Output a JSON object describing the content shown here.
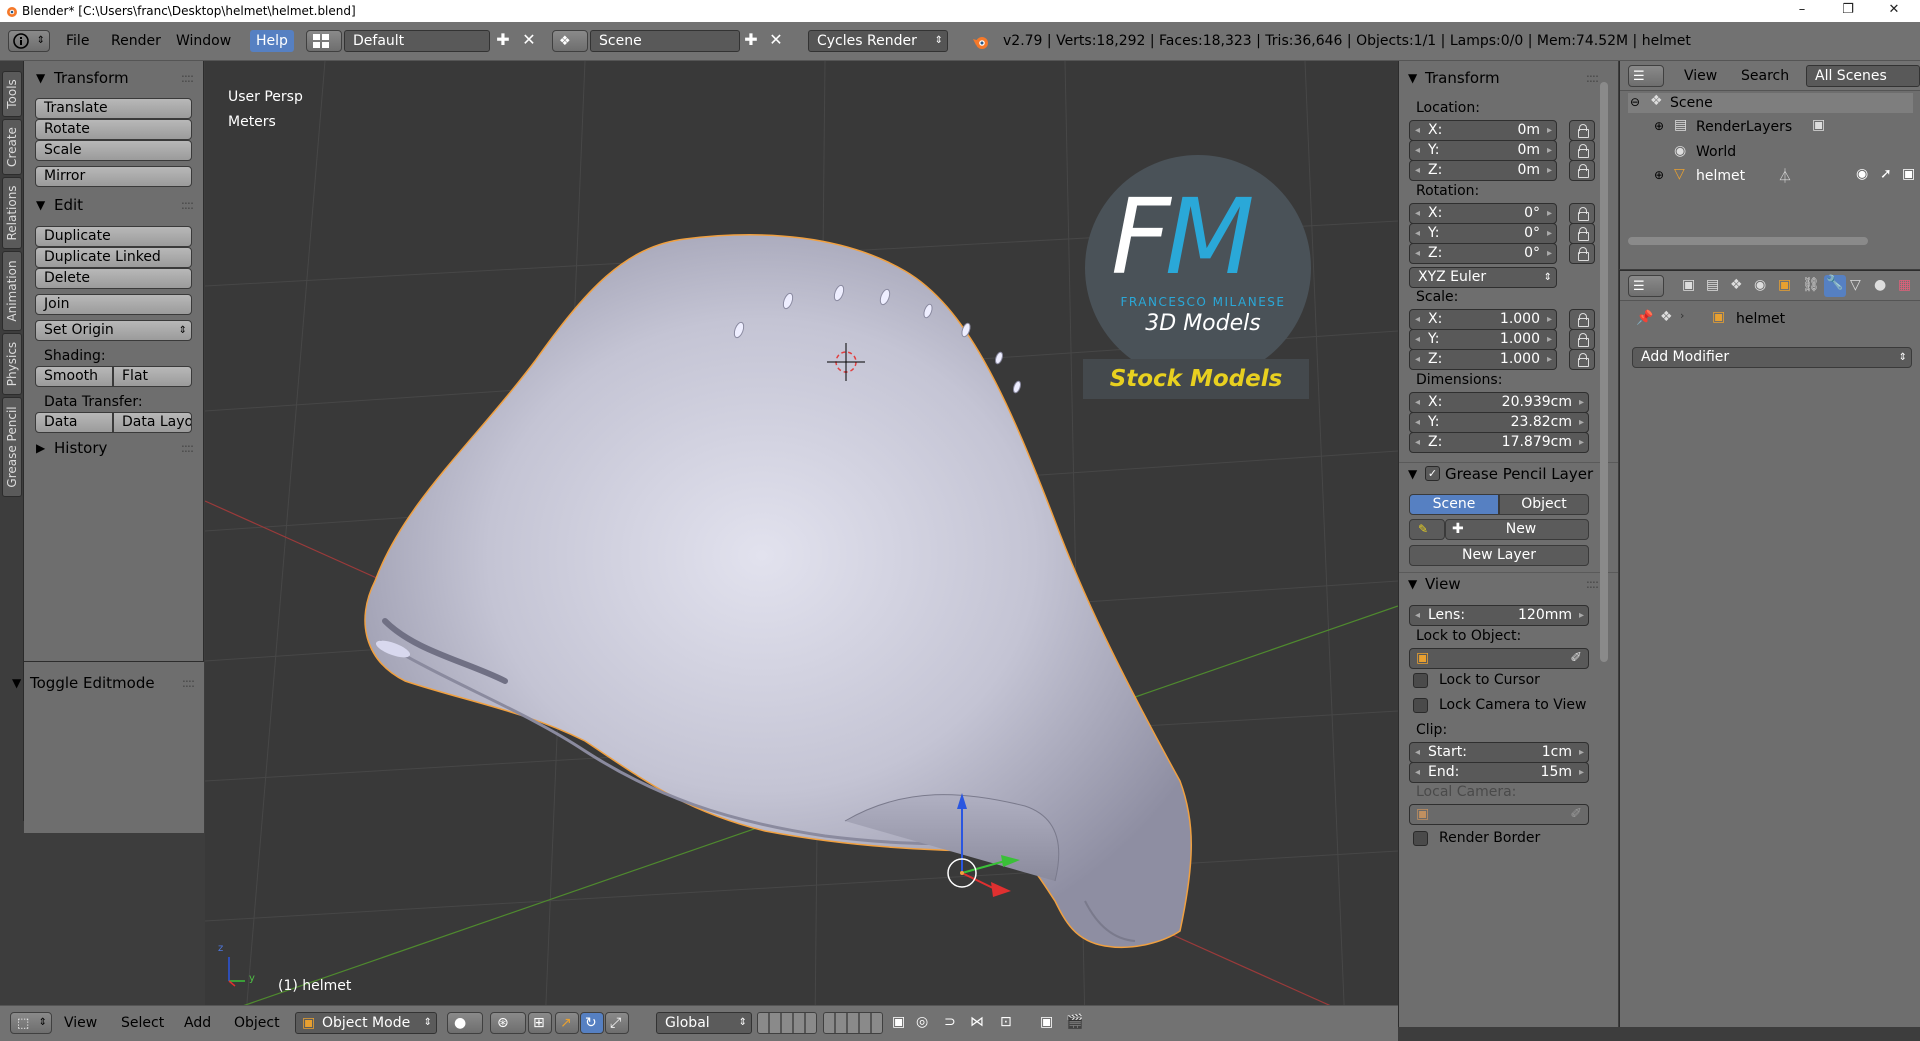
{
  "window": {
    "title": "Blender* [C:\\Users\\franc\\Desktop\\helmet\\helmet.blend]",
    "minimize": "–",
    "maximize": "❐",
    "close": "✕"
  },
  "info_header": {
    "menus": [
      "File",
      "Render",
      "Window",
      "Help"
    ],
    "active_menu": "Help",
    "layout": "Default",
    "scene": "Scene",
    "engine": "Cycles Render",
    "stats": "v2.79 | Verts:18,292 | Faces:18,323 | Tris:36,646 | Objects:1/1 | Lamps:0/0 | Mem:74.52M | helmet"
  },
  "tool_tabs": [
    "Tools",
    "Create",
    "Relations",
    "Animation",
    "Physics",
    "Grease Pencil"
  ],
  "toolshelf": {
    "transform": {
      "title": "Transform",
      "buttons": [
        "Translate",
        "Rotate",
        "Scale",
        "Mirror"
      ]
    },
    "edit": {
      "title": "Edit",
      "buttons": [
        "Duplicate",
        "Duplicate Linked",
        "Delete",
        "Join"
      ],
      "set_origin": "Set Origin",
      "shading_label": "Shading:",
      "smooth": "Smooth",
      "flat": "Flat",
      "data_transfer_label": "Data Transfer:",
      "data": "Data",
      "data_layout": "Data Layo"
    },
    "history": "History",
    "toggle_editmode": "Toggle Editmode"
  },
  "viewport": {
    "view_name": "User Persp",
    "units": "Meters",
    "object_label": "(1) helmet",
    "logo_letters": "FM",
    "logo_author": "FRANCESCO MILANESE",
    "logo_sub": "3D Models",
    "logo_banner": "Stock Models",
    "axis_z": "z",
    "axis_y": "y"
  },
  "properties": {
    "transform_title": "Transform",
    "location_label": "Location:",
    "location": [
      {
        "axis": "X:",
        "value": "0m"
      },
      {
        "axis": "Y:",
        "value": "0m"
      },
      {
        "axis": "Z:",
        "value": "0m"
      }
    ],
    "rotation_label": "Rotation:",
    "rotation": [
      {
        "axis": "X:",
        "value": "0°"
      },
      {
        "axis": "Y:",
        "value": "0°"
      },
      {
        "axis": "Z:",
        "value": "0°"
      }
    ],
    "rotation_mode": "XYZ Euler",
    "scale_label": "Scale:",
    "scale": [
      {
        "axis": "X:",
        "value": "1.000"
      },
      {
        "axis": "Y:",
        "value": "1.000"
      },
      {
        "axis": "Z:",
        "value": "1.000"
      }
    ],
    "dimensions_label": "Dimensions:",
    "dimensions": [
      {
        "axis": "X:",
        "value": "20.939cm"
      },
      {
        "axis": "Y:",
        "value": "23.82cm"
      },
      {
        "axis": "Z:",
        "value": "17.879cm"
      }
    ],
    "grease_title": "Grease Pencil Layer",
    "grease_scene": "Scene",
    "grease_object": "Object",
    "grease_new": "New",
    "new_layer": "New Layer",
    "view_title": "View",
    "lens_label": "Lens:",
    "lens_value": "120mm",
    "lock_to_object": "Lock to Object:",
    "lock_to_cursor": "Lock to Cursor",
    "lock_camera": "Lock Camera to View",
    "clip_label": "Clip:",
    "clip_start_label": "Start:",
    "clip_start": "1cm",
    "clip_end_label": "End:",
    "clip_end": "15m",
    "local_camera": "Local Camera:",
    "render_border": "Render Border"
  },
  "outliner": {
    "view": "View",
    "search": "Search",
    "filter": "All Scenes",
    "items": [
      "Scene",
      "RenderLayers",
      "World",
      "helmet"
    ]
  },
  "modifiers": {
    "object_name": "helmet",
    "add_modifier": "Add Modifier"
  },
  "view3d_header": {
    "menus": [
      "View",
      "Select",
      "Add",
      "Object"
    ],
    "mode": "Object Mode",
    "orientation": "Global"
  },
  "colors": {
    "accent": "#5680c2",
    "panel": "#6e6e6e",
    "viewport": "#393939",
    "selection_outline": "#f0a040",
    "logo_blue": "#2aa8d8",
    "logo_yellow": "#e8d020"
  }
}
